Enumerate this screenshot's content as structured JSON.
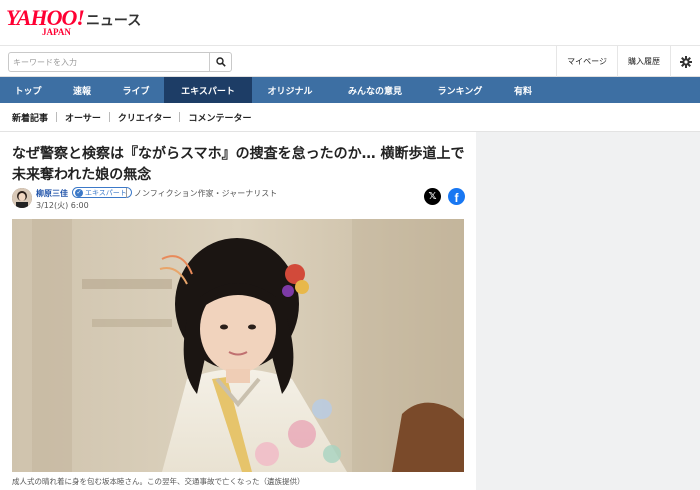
{
  "header": {
    "logo_main": "YAHOO!",
    "logo_sub": "JAPAN",
    "logo_news": "ニュース"
  },
  "search": {
    "placeholder": "キーワードを入力",
    "value": ""
  },
  "right_links": {
    "mypage": "マイページ",
    "history": "購入履歴"
  },
  "nav": [
    {
      "label": "トップ"
    },
    {
      "label": "速報"
    },
    {
      "label": "ライブ"
    },
    {
      "label": "エキスパート"
    },
    {
      "label": "オリジナル"
    },
    {
      "label": "みんなの意見"
    },
    {
      "label": "ランキング"
    },
    {
      "label": "有料"
    }
  ],
  "subnav": [
    {
      "label": "新着記事"
    },
    {
      "label": "オーサー"
    },
    {
      "label": "クリエイター"
    },
    {
      "label": "コメンテーター"
    }
  ],
  "article": {
    "title": "なぜ警察と検察は『ながらスマホ』の捜査を怠ったのか… 横断歩道上で未来奪われた娘の無念",
    "author": "柳原三佳",
    "badge": "エキスパート",
    "author_desc": "ノンフィクション作家・ジャーナリスト",
    "date": "3/12(火) 6:00",
    "caption": "成人式の晴れ着に身を包む坂本睦さん。この翌年、交通事故で亡くなった（遺族提供）"
  },
  "share": {
    "x_glyph": "𝕏",
    "fb_glyph": "f"
  },
  "colors": {
    "brand_red": "#ff0033",
    "nav_blue": "#3d6fa3",
    "nav_active": "#1d3d66",
    "facebook": "#1877f2"
  }
}
